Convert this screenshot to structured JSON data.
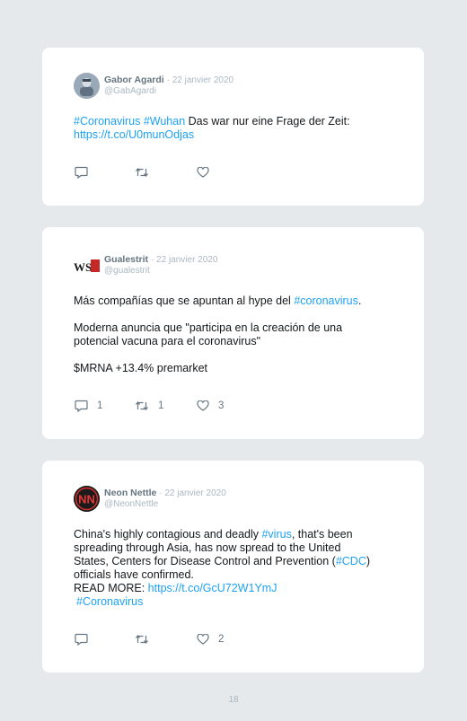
{
  "tweets": [
    {
      "name": "Gabor Agardi",
      "date": "· 22 janvier 2020",
      "handle": "@GabAgardi",
      "text": {
        "tag1": "#Coronavirus",
        "tag2": "#Wuhan",
        "plain": "Das war nur eine Frage der Zeit:",
        "url": "https://t.co/U0munOdjas"
      },
      "reply_count": "",
      "retweet_count": "",
      "like_count": ""
    },
    {
      "name": "Gualestrit",
      "date": "· 22 janvier 2020",
      "handle": "@gualestrit",
      "avatar_text": "WSN",
      "text": {
        "line1_pre": "Más compañías que se apuntan al hype del",
        "line1_tag": "#coronavirus",
        "line1_post": ".",
        "line2": "Moderna anuncia que \"participa en la creación de una",
        "line3": "potencial vacuna para el coronavirus\"",
        "line4": "$MRNA +13.4% premarket"
      },
      "reply_count": "1",
      "retweet_count": "1",
      "like_count": "3"
    },
    {
      "name": "Neon Nettle",
      "date": "· 22 janvier 2020",
      "handle": "@NeonNettle",
      "avatar_text": "NN",
      "text": {
        "line1_pre": "China's highly contagious and deadly",
        "line1_tag": "#virus",
        "line1_post": ", that's been",
        "line2": "spreading through Asia, has now spread to the United",
        "line3_pre": "States, Centers for Disease Control and Prevention (",
        "line3_tag": "#CDC",
        "line3_post": ")",
        "line4": "officials have confirmed.",
        "line5_pre": "READ MORE:",
        "line5_url": "https://t.co/GcU72W1YmJ",
        "line6_tag": "#Coronavirus"
      },
      "reply_count": "",
      "retweet_count": "",
      "like_count": "2"
    }
  ],
  "page_number": "18",
  "colors": {
    "background": "#e6e9ec",
    "card": "#ffffff",
    "link": "#1da1f2",
    "muted": "#aab8c2",
    "name": "#66757f"
  },
  "icons": [
    "reply-icon",
    "retweet-icon",
    "like-icon"
  ]
}
